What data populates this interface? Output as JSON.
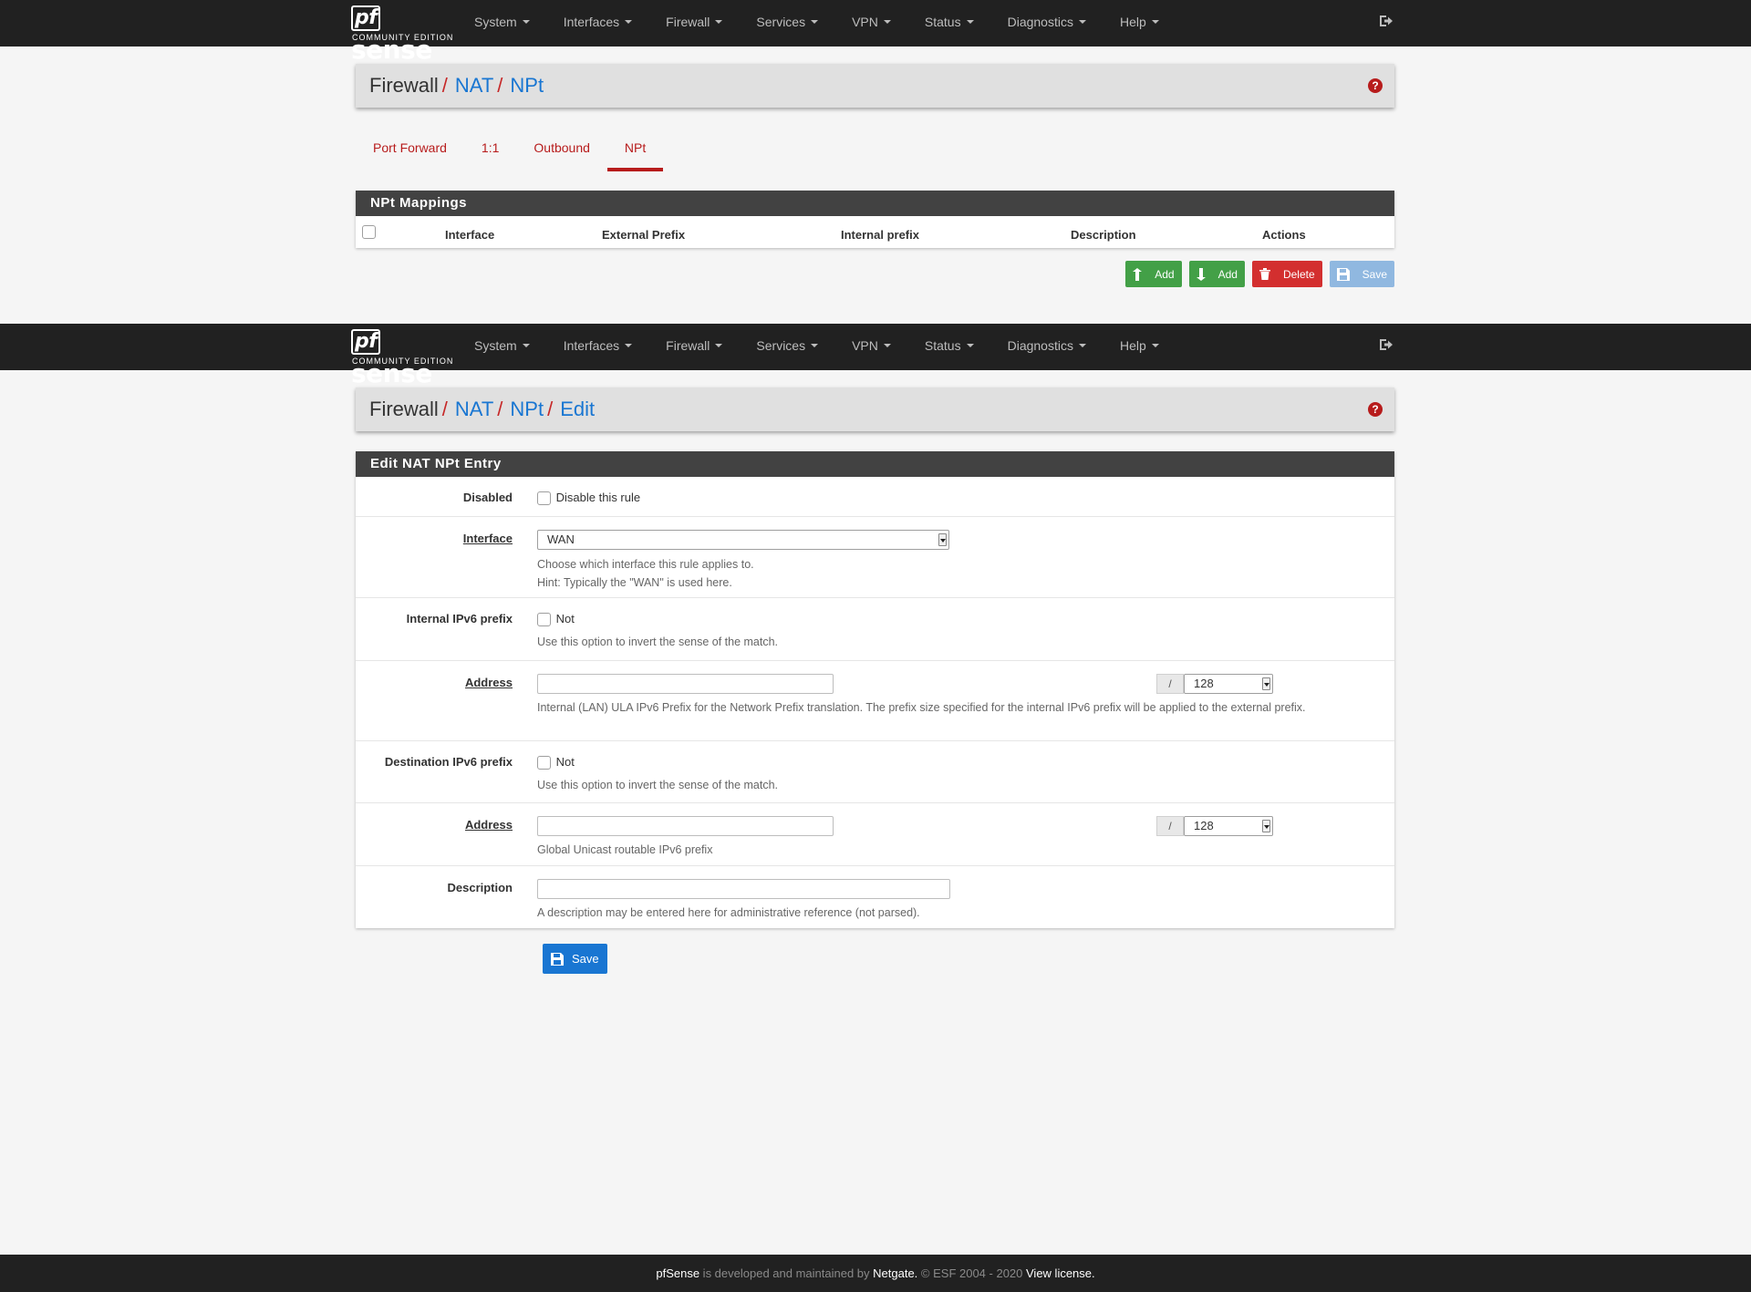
{
  "brand": {
    "name": "sense",
    "prefix": "pf",
    "edition": "COMMUNITY EDITION"
  },
  "nav": [
    "System",
    "Interfaces",
    "Firewall",
    "Services",
    "VPN",
    "Status",
    "Diagnostics",
    "Help"
  ],
  "list_view": {
    "breadcrumb": {
      "root": "Firewall",
      "links": [
        "NAT",
        "NPt"
      ]
    },
    "tabs": [
      "Port Forward",
      "1:1",
      "Outbound",
      "NPt"
    ],
    "active_tab": "NPt",
    "panel_title": "NPt Mappings",
    "columns": [
      "Interface",
      "External Prefix",
      "Internal prefix",
      "Description",
      "Actions"
    ],
    "buttons": {
      "add_top": "Add",
      "add_bottom": "Add",
      "delete": "Delete",
      "save": "Save"
    }
  },
  "edit_view": {
    "breadcrumb": {
      "root": "Firewall",
      "links": [
        "NAT",
        "NPt",
        "Edit"
      ]
    },
    "panel_title": "Edit NAT NPt Entry",
    "disabled": {
      "label": "Disabled",
      "checkbox_label": "Disable this rule"
    },
    "interface": {
      "label": "Interface",
      "value": "WAN",
      "hint1": "Choose which interface this rule applies to.",
      "hint2": "Hint: Typically the \"WAN\" is used here."
    },
    "internal_prefix": {
      "label": "Internal IPv6 prefix",
      "not_label": "Not",
      "hint": "Use this option to invert the sense of the match."
    },
    "internal_address": {
      "label": "Address",
      "value": "",
      "slash": "/",
      "mask": "128",
      "hint": "Internal (LAN) ULA IPv6 Prefix for the Network Prefix translation. The prefix size specified for the internal IPv6 prefix will be applied to the external prefix."
    },
    "destination_prefix": {
      "label": "Destination IPv6 prefix",
      "not_label": "Not",
      "hint": "Use this option to invert the sense of the match."
    },
    "destination_address": {
      "label": "Address",
      "value": "",
      "slash": "/",
      "mask": "128",
      "hint": "Global Unicast routable IPv6 prefix"
    },
    "description": {
      "label": "Description",
      "value": "",
      "hint": "A description may be entered here for administrative reference (not parsed)."
    },
    "save_label": "Save"
  },
  "footer": {
    "brand": "pfSense",
    "text1": " is developed and maintained by ",
    "company": "Netgate.",
    "text2": " © ESF 2004 - 2020 ",
    "license": "View license."
  },
  "colors": {
    "navbar": "#212121",
    "accent_red": "#b71c1c",
    "link_blue": "#1976d2",
    "add_green": "#43a047",
    "delete_red": "#d32f2f"
  }
}
